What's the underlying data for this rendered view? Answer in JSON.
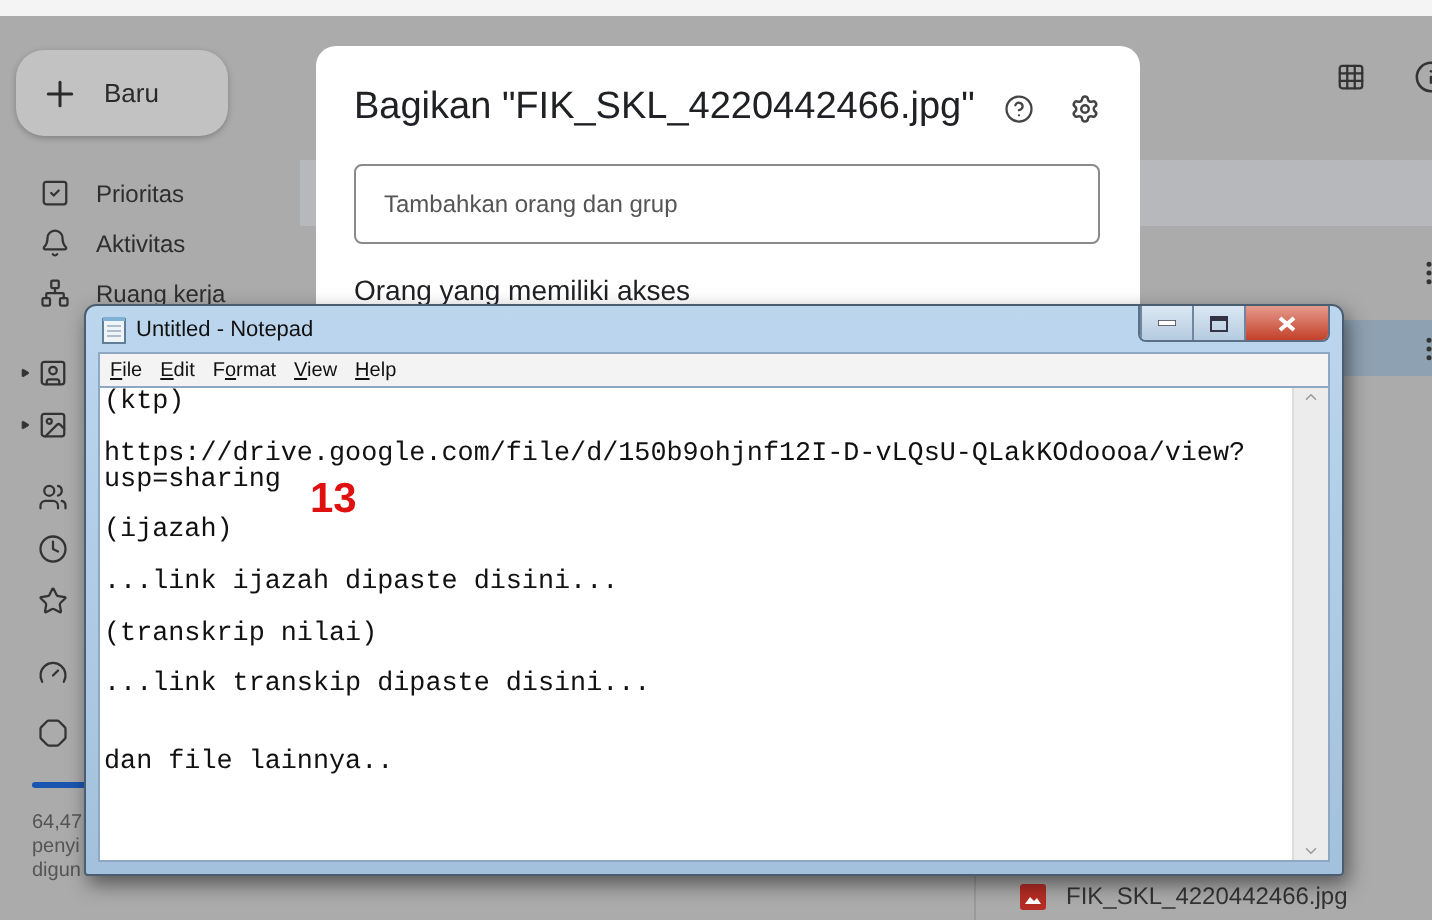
{
  "drive": {
    "new_button": "Baru",
    "nav": [
      {
        "label": "Prioritas"
      },
      {
        "label": "Aktivitas"
      },
      {
        "label": "Ruang kerja"
      }
    ],
    "storage_lines": [
      "64,47",
      "penyi",
      "digun"
    ],
    "files": [
      {
        "name": "FIK_SKL_4220442466.jpg"
      }
    ]
  },
  "share_dialog": {
    "title": "Bagikan \"FIK_SKL_4220442466.jpg\"",
    "placeholder": "Tambahkan orang dan grup",
    "access_heading": "Orang yang memiliki akses"
  },
  "notepad": {
    "title": "Untitled - Notepad",
    "menu": [
      {
        "key": "F",
        "rest": "ile"
      },
      {
        "key": "E",
        "rest": "dit"
      },
      {
        "pre": "F",
        "key": "o",
        "rest": "rmat"
      },
      {
        "key": "V",
        "rest": "iew"
      },
      {
        "key": "H",
        "rest": "elp"
      }
    ],
    "lines": [
      {
        "kind": "text",
        "text": "(ktp)"
      },
      {
        "kind": "blank"
      },
      {
        "kind": "text",
        "text": "https://drive.google.com/file/d/150b9ohjnf12I-D-vLQsU-QLakKOdoooa/view?"
      },
      {
        "kind": "text",
        "text": "usp=sharing"
      },
      {
        "kind": "blank"
      },
      {
        "kind": "text",
        "text": "(ijazah)"
      },
      {
        "kind": "blank"
      },
      {
        "kind": "text",
        "text": "...link ijazah dipaste disini..."
      },
      {
        "kind": "blank"
      },
      {
        "kind": "text",
        "text": "(transkrip nilai)"
      },
      {
        "kind": "blank"
      },
      {
        "kind": "text",
        "text": "...link transkip dipaste disini..."
      },
      {
        "kind": "blank"
      },
      {
        "kind": "blank"
      },
      {
        "kind": "text",
        "text": "dan file lainnya.."
      }
    ]
  },
  "annotation": "13"
}
